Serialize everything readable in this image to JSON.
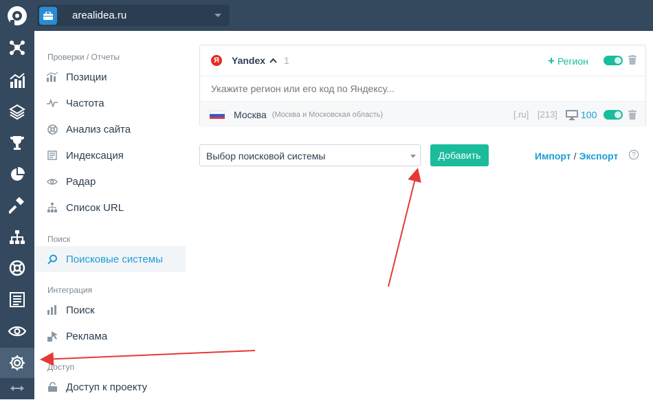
{
  "header": {
    "logo_icon": "app-logo-icon",
    "project_icon": "briefcase-icon",
    "project_name": "arealidea.ru"
  },
  "iconbar": {
    "items": [
      {
        "icon": "network-icon"
      },
      {
        "icon": "analytics-icon"
      },
      {
        "icon": "layers-icon"
      },
      {
        "icon": "trophy-icon"
      },
      {
        "icon": "pie-chart-icon"
      },
      {
        "icon": "hammer-icon"
      },
      {
        "icon": "sitemap-icon"
      },
      {
        "icon": "lifebuoy-icon"
      },
      {
        "icon": "report-icon"
      },
      {
        "icon": "eye-icon"
      },
      {
        "icon": "gear-icon",
        "active": true
      },
      {
        "icon": "expand-arrows-icon"
      }
    ]
  },
  "sidebar": {
    "section_checks": "Проверки / Отчеты",
    "checks": [
      {
        "label": "Позиции",
        "icon": "bar-chart-icon"
      },
      {
        "label": "Частота",
        "icon": "pulse-icon"
      },
      {
        "label": "Анализ сайта",
        "icon": "lifebuoy-icon"
      },
      {
        "label": "Индексация",
        "icon": "document-icon"
      },
      {
        "label": "Радар",
        "icon": "eye-icon"
      },
      {
        "label": "Список URL",
        "icon": "sitemap-icon"
      }
    ],
    "section_search": "Поиск",
    "search_items": [
      {
        "label": "Поисковые системы",
        "icon": "search-icon",
        "active": true
      }
    ],
    "section_integration": "Интеграция",
    "integration_items": [
      {
        "label": "Поиск",
        "icon": "bar-chart-icon"
      },
      {
        "label": "Реклама",
        "icon": "ads-icon"
      }
    ],
    "section_access": "Доступ",
    "access_items": [
      {
        "label": "Доступ к проекту",
        "icon": "lock-icon"
      }
    ]
  },
  "engine_card": {
    "logo_letter": "Я",
    "engine_name": "Yandex",
    "region_count": "1",
    "add_region_plus": "+",
    "add_region_label": "Регион",
    "region_placeholder": "Укажите регион или его код по Яндексу...",
    "region": {
      "city": "Москва",
      "city_detail": "(Москва и Московская область)",
      "domain": "[.ru]",
      "code": "[213]",
      "device_value": "100"
    }
  },
  "controls": {
    "select_value": "Выбор поисковой системы",
    "add_button": "Добавить",
    "import_label": "Импорт",
    "separator": "/",
    "export_label": "Экспорт",
    "help_symbol": "?"
  },
  "colors": {
    "sidebar_dark": "#34495e",
    "accent_green": "#1abc9c",
    "accent_blue": "#1e9bd7",
    "annotation_red": "#e53935"
  }
}
